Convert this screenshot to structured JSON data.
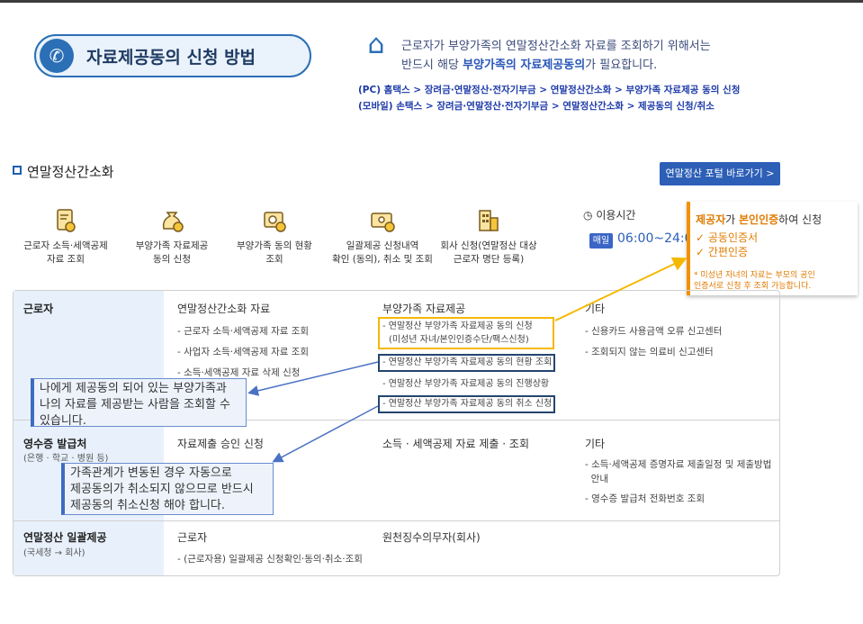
{
  "header": {
    "title": "자료제공동의 신청 방법",
    "notice_line1": "근로자가 부양가족의 연말정산간소화 자료를 조회하기 위해서는",
    "notice_line2_prefix": "반드시 해당 ",
    "notice_line2_highlight": "부양가족의 자료제공동의",
    "notice_line2_suffix": "가 필요합니다.",
    "path_pc": "(PC) 홈택스 > 장려금·연말정산·전자기부금 > 연말정산간소화 > 부양가족 자료제공 동의 신청",
    "path_mobile": "(모바일) 손택스 > 장려금·연말정산·전자기부금 > 연말정산간소화 > 제공동의 신청/취소"
  },
  "section": {
    "title": "연말정산간소화",
    "portal_button": "연말정산 포털 바로가기  >"
  },
  "services": [
    {
      "label": "근로자 소득·세액공제\n자료 조회",
      "icon": "document-coin-icon"
    },
    {
      "label": "부양가족 자료제공\n동의 신청",
      "icon": "money-bag-icon"
    },
    {
      "label": "부양가족 동의 현황\n조회",
      "icon": "search-person-icon"
    },
    {
      "label": "일괄제공 신청내역\n확인 (동의), 취소 및 조회",
      "icon": "batch-folder-icon"
    },
    {
      "label": "회사 신청(연말정산 대상\n근로자 명단 등록)",
      "icon": "building-icon"
    }
  ],
  "hours": {
    "label": "이용시간",
    "badge": "매일",
    "time": "06:00~24:00"
  },
  "callout": {
    "title_a": "제공자",
    "title_b": "가 ",
    "title_c": "본인인증",
    "title_d": "하여 신청",
    "item1": "✓  공동인증서",
    "item2": "✓  간편인증",
    "note": "* 미성년 자녀의 자료는 부모의 공인\n  인증서로 신청 후 조회 가능합니다."
  },
  "table": {
    "row1": {
      "head": "근로자",
      "col2_title": "연말정산간소화 자료",
      "col2_items": [
        "- 근로자 소득·세액공제 자료 조회",
        "- 사업자 소득·세액공제 자료 조회",
        "- 소득·세액공제 자료 삭제 신청"
      ],
      "col3_title": "부양가족 자료제공",
      "col3_items": [
        "- 연말정산 부양가족 자료제공 동의 신청",
        "(미성년 자녀/본인인증수단/팩스신청)",
        "- 연말정산 부양가족 자료제공 동의 현황 조회",
        "- 연말정산 부양가족 자료제공 동의 진행상황",
        "- 연말정산 부양가족 자료제공 동의 취소 신청"
      ],
      "col4_title": "기타",
      "col4_items": [
        "- 신용카드 사용금액 오류 신고센터",
        "- 조회되지 않는 의료비 신고센터"
      ]
    },
    "row2": {
      "head": "영수증 발급처",
      "sub": "(은행 · 학교 · 병원 등)",
      "col2_title": "자료제출 승인 신청",
      "col3_title": "소득 · 세액공제 자료 제출 · 조회",
      "col4_title": "기타",
      "col4_items": [
        "- 소득·세액공제 증명자료 제출일정 및 제출방법",
        "  안내",
        "- 영수증 발급처 전화번호 조회"
      ]
    },
    "row3": {
      "head": "연말정산 일괄제공",
      "sub": "(국세청 → 회사)",
      "col2_title": "근로자",
      "col2_item": "- (근로자용) 일괄제공 신청확인·동의·취소·조회",
      "col3_title": "원천징수의무자(회사)"
    }
  },
  "notes": {
    "note1": "나에게 제공동의 되어 있는 부양가족과\n나의 자료를 제공받는 사람을 조회할 수\n있습니다.",
    "note2": "가족관계가 변동된 경우 자동으로\n제공동의가 취소되지 않으므로 반드시\n제공동의 취소신청 해야 합니다."
  },
  "colors": {
    "brand_blue": "#2b6fb6",
    "orange": "#f29100",
    "yellow_box": "#f5b800",
    "navy_box": "#24456e"
  }
}
